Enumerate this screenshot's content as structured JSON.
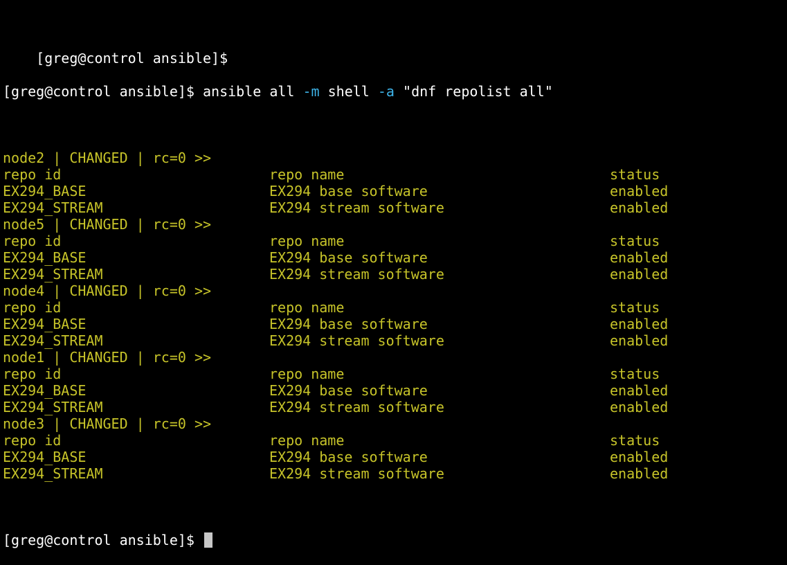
{
  "prompt": "[greg@control ansible]$",
  "command": {
    "part1": " ansible all ",
    "flag_m": "-m",
    "part2": " shell ",
    "flag_a": "-a",
    "part3": " \"dnf repolist all\""
  },
  "colors": {
    "background": "#000000",
    "output": "#c7c429",
    "flag": "#3db3e8",
    "prompt": "#ffffff"
  },
  "hosts": [
    {
      "header": "node2 | CHANGED | rc=0 >>",
      "table_header": {
        "id": "repo id",
        "name": "repo name",
        "status": "status"
      },
      "rows": [
        {
          "id": "EX294_BASE",
          "name": "EX294 base software",
          "status": "enabled"
        },
        {
          "id": "EX294_STREAM",
          "name": "EX294 stream software",
          "status": "enabled"
        }
      ]
    },
    {
      "header": "node5 | CHANGED | rc=0 >>",
      "table_header": {
        "id": "repo id",
        "name": "repo name",
        "status": "status"
      },
      "rows": [
        {
          "id": "EX294_BASE",
          "name": "EX294 base software",
          "status": "enabled"
        },
        {
          "id": "EX294_STREAM",
          "name": "EX294 stream software",
          "status": "enabled"
        }
      ]
    },
    {
      "header": "node4 | CHANGED | rc=0 >>",
      "table_header": {
        "id": "repo id",
        "name": "repo name",
        "status": "status"
      },
      "rows": [
        {
          "id": "EX294_BASE",
          "name": "EX294 base software",
          "status": "enabled"
        },
        {
          "id": "EX294_STREAM",
          "name": "EX294 stream software",
          "status": "enabled"
        }
      ]
    },
    {
      "header": "node1 | CHANGED | rc=0 >>",
      "table_header": {
        "id": "repo id",
        "name": "repo name",
        "status": "status"
      },
      "rows": [
        {
          "id": "EX294_BASE",
          "name": "EX294 base software",
          "status": "enabled"
        },
        {
          "id": "EX294_STREAM",
          "name": "EX294 stream software",
          "status": "enabled"
        }
      ]
    },
    {
      "header": "node3 | CHANGED | rc=0 >>",
      "table_header": {
        "id": "repo id",
        "name": "repo name",
        "status": "status"
      },
      "rows": [
        {
          "id": "EX294_BASE",
          "name": "EX294 base software",
          "status": "enabled"
        },
        {
          "id": "EX294_STREAM",
          "name": "EX294 stream software",
          "status": "enabled"
        }
      ]
    }
  ]
}
